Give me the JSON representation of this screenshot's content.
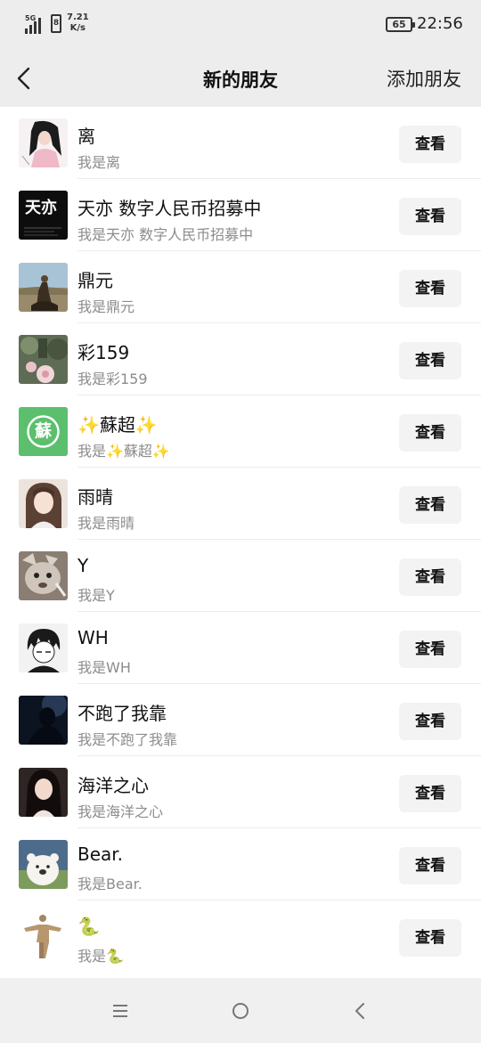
{
  "status_bar": {
    "network": "5G",
    "sim": "8",
    "speed_value": "7.21",
    "speed_unit": "K/s",
    "battery": "65",
    "time": "22:56"
  },
  "header": {
    "title": "新的朋友",
    "action": "添加朋友"
  },
  "button_label": "查看",
  "friends": [
    {
      "name": "离",
      "message": "我是离"
    },
    {
      "name": "天亦 数字人民币招募中",
      "message": "我是天亦 数字人民币招募中"
    },
    {
      "name": "鼎元",
      "message": "我是鼎元"
    },
    {
      "name": "彩159",
      "message": "我是彩159"
    },
    {
      "name": "✨蘇超✨",
      "message": "我是✨蘇超✨"
    },
    {
      "name": "雨晴",
      "message": "我是雨晴"
    },
    {
      "name": "Y",
      "message": "我是Y"
    },
    {
      "name": "WH",
      "message": "我是WH"
    },
    {
      "name": "不跑了我靠",
      "message": "我是不跑了我靠"
    },
    {
      "name": "海洋之心",
      "message": "我是海洋之心"
    },
    {
      "name": "Bear.",
      "message": "我是Bear."
    },
    {
      "name": "🐍",
      "message": "我是🐍"
    }
  ],
  "avatar_text": {
    "tianyi": "天亦",
    "suchao": "蘇"
  },
  "colors": {
    "background": "#ededed",
    "list": "#ffffff",
    "button": "#f3f3f3",
    "suchao_green": "#5cbf6e"
  }
}
